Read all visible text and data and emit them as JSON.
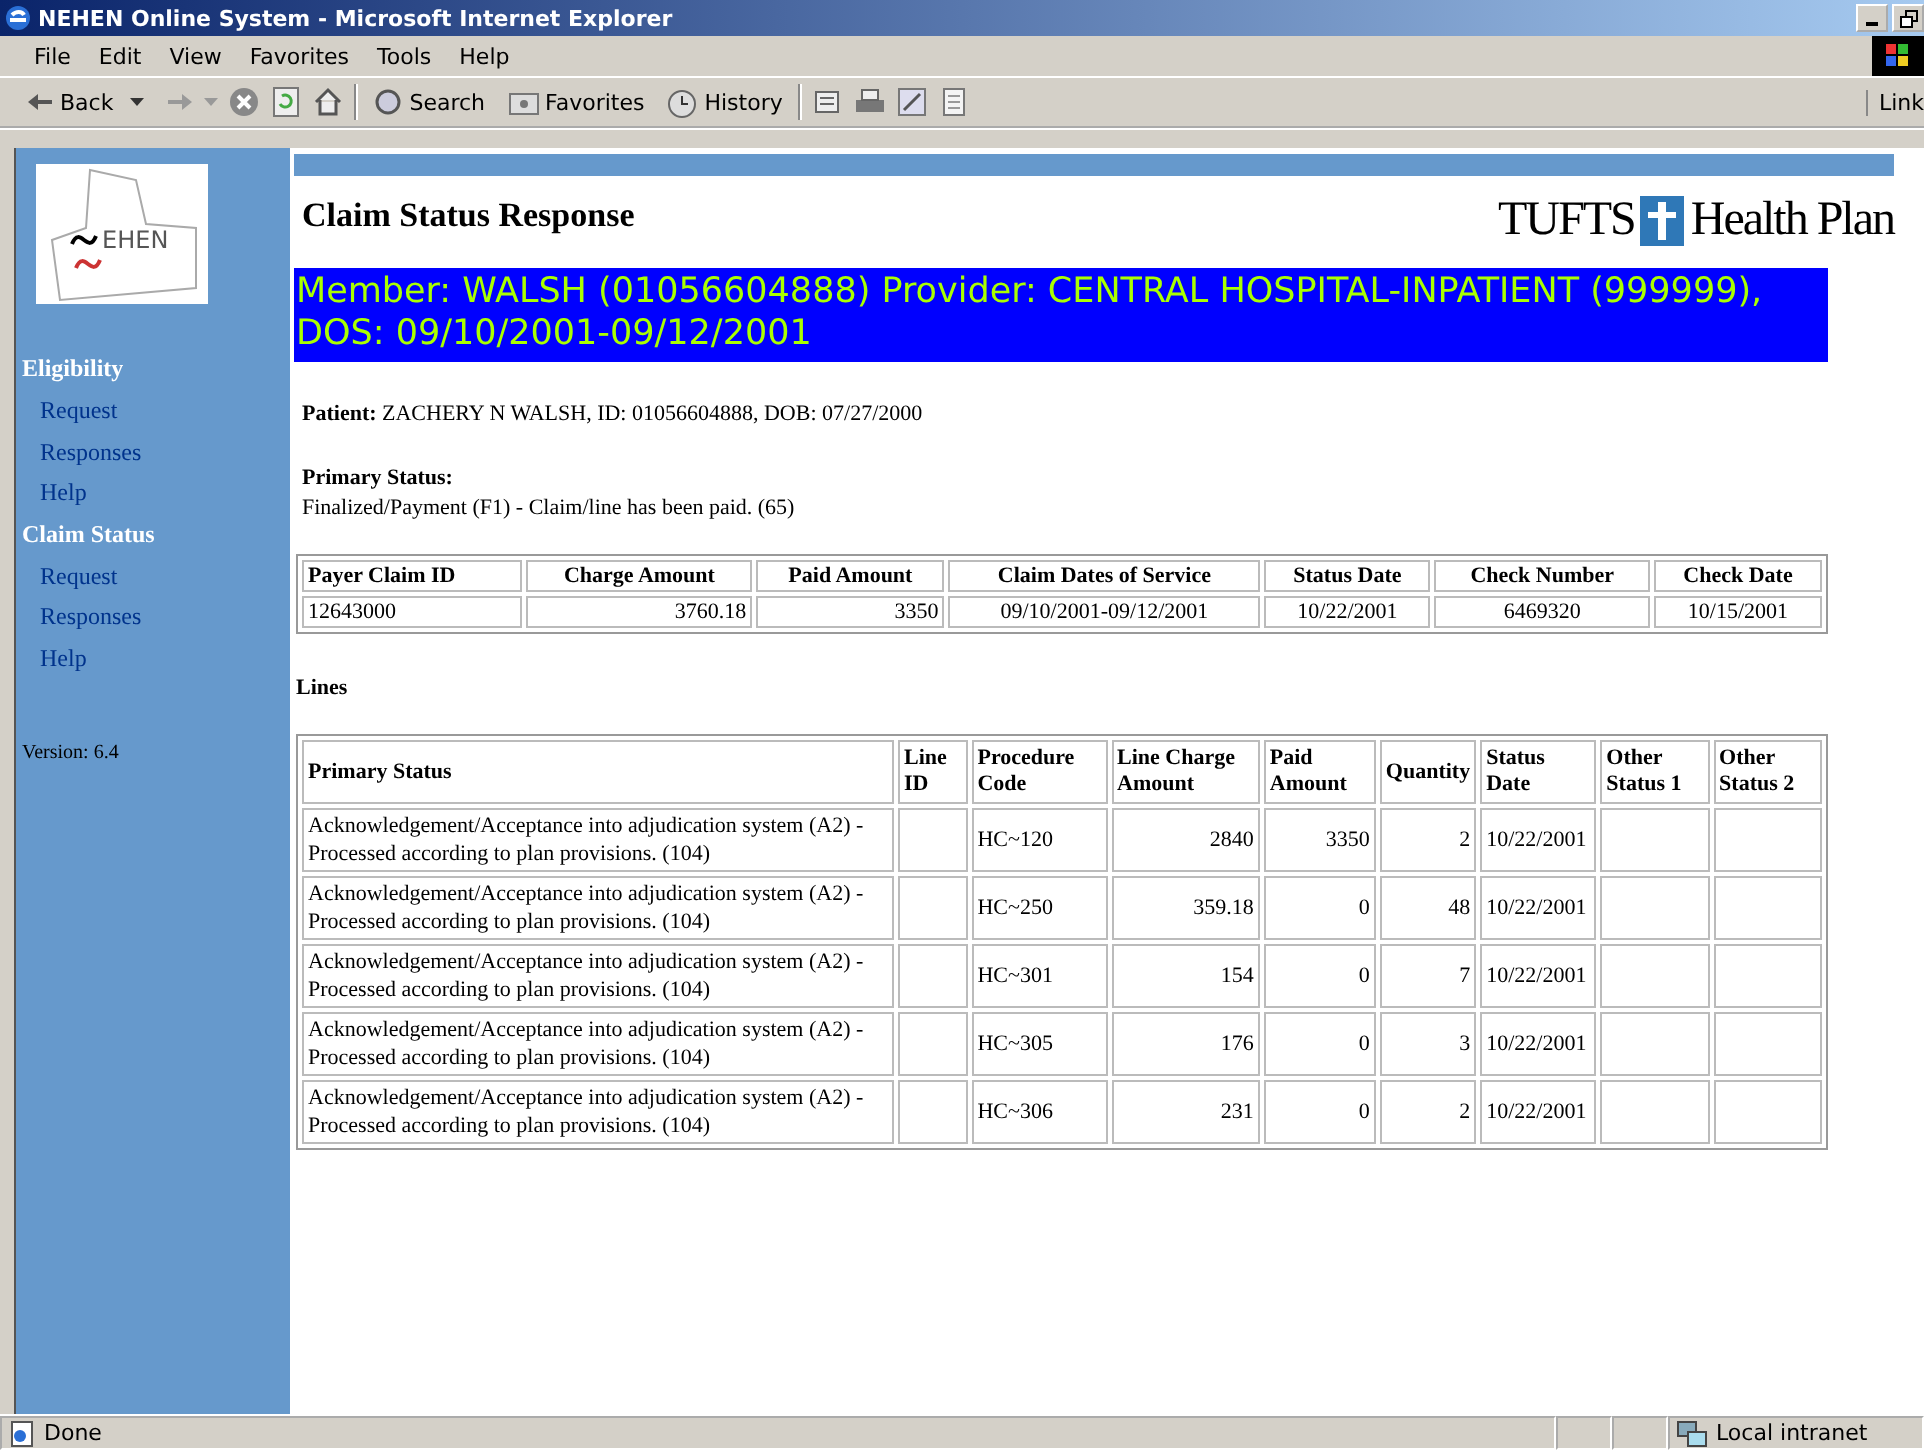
{
  "window": {
    "title": "NEHEN Online System - Microsoft Internet Explorer"
  },
  "menu": [
    "File",
    "Edit",
    "View",
    "Favorites",
    "Tools",
    "Help"
  ],
  "toolbar": {
    "back": "Back",
    "search": "Search",
    "favorites": "Favorites",
    "history": "History",
    "links": "Link"
  },
  "sidebar": {
    "logo_text": "EHEN",
    "sections": [
      {
        "title": "Eligibility",
        "items": [
          "Request",
          "Responses",
          "Help"
        ]
      },
      {
        "title": "Claim Status",
        "items": [
          "Request",
          "Responses",
          "Help"
        ]
      }
    ],
    "version": "Version: 6.4"
  },
  "page": {
    "heading": "Claim Status Response",
    "brand": {
      "left": "TUFTS",
      "right": "Health Plan"
    },
    "banner": "Member: WALSH (01056604888) Provider: CENTRAL HOSPITAL-INPATIENT (999999), DOS: 09/10/2001-09/12/2001",
    "patient": {
      "label": "Patient:",
      "value": "ZACHERY N WALSH, ID: 01056604888, DOB: 07/27/2000"
    },
    "primary_status": {
      "label": "Primary Status:",
      "value": "Finalized/Payment (F1) - Claim/line has been paid. (65)"
    },
    "claim_table": {
      "columns": [
        "Payer Claim ID",
        "Charge Amount",
        "Paid Amount",
        "Claim Dates of Service",
        "Status Date",
        "Check Number",
        "Check Date"
      ],
      "rows": [
        [
          "12643000",
          "3760.18",
          "3350",
          "09/10/2001-09/12/2001",
          "10/22/2001",
          "6469320",
          "10/15/2001"
        ]
      ]
    },
    "lines_heading": "Lines",
    "lines_table": {
      "columns": [
        "Primary Status",
        "Line ID",
        "Procedure Code",
        "Line Charge Amount",
        "Paid Amount",
        "Quantity",
        "Status Date",
        "Other Status 1",
        "Other Status 2"
      ],
      "rows": [
        [
          "Acknowledgement/Acceptance into adjudication system (A2) - Processed according to plan provisions. (104)",
          "",
          "HC~120",
          "2840",
          "3350",
          "2",
          "10/22/2001",
          "",
          ""
        ],
        [
          "Acknowledgement/Acceptance into adjudication system (A2) - Processed according to plan provisions. (104)",
          "",
          "HC~250",
          "359.18",
          "0",
          "48",
          "10/22/2001",
          "",
          ""
        ],
        [
          "Acknowledgement/Acceptance into adjudication system (A2) - Processed according to plan provisions. (104)",
          "",
          "HC~301",
          "154",
          "0",
          "7",
          "10/22/2001",
          "",
          ""
        ],
        [
          "Acknowledgement/Acceptance into adjudication system (A2) - Processed according to plan provisions. (104)",
          "",
          "HC~305",
          "176",
          "0",
          "3",
          "10/22/2001",
          "",
          ""
        ],
        [
          "Acknowledgement/Acceptance into adjudication system (A2) - Processed according to plan provisions. (104)",
          "",
          "HC~306",
          "231",
          "0",
          "2",
          "10/22/2001",
          "",
          ""
        ]
      ]
    }
  },
  "status_bar": {
    "text": "Done",
    "zone": "Local intranet"
  }
}
